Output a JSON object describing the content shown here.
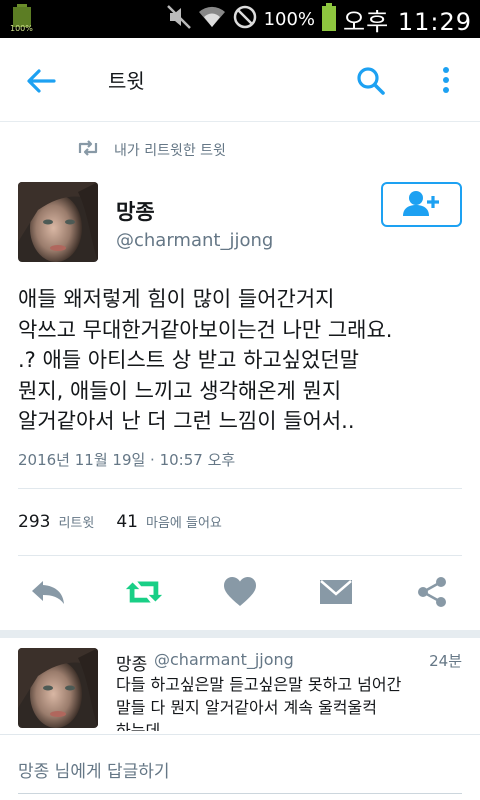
{
  "status_bar": {
    "battery_left_label": "100%",
    "battery_percent": "100%",
    "time": "오후 11:29",
    "icons": [
      "sound-muted-icon",
      "wifi-icon",
      "blocked-icon",
      "battery-icon"
    ]
  },
  "toolbar": {
    "title": "트윗",
    "back_icon": "back-arrow-icon",
    "search_icon": "search-icon",
    "more_icon": "more-vert-icon"
  },
  "tweet": {
    "retweet_context": "내가 리트윗한 트윗",
    "author_name": "망종",
    "author_handle": "@charmant_jjong",
    "text": "애들 왜저렇게 힘이 많이 들어간거지\n악쓰고 무대한거같아보이는건 나만 그래요.\n.? 애들 아티스트 상 받고 하고싶었던말\n뭔지, 애들이 느끼고 생각해온게 뭔지\n알거같아서 난 더 그런 느낌이 들어서..",
    "timestamp": "2016년 11월 19일 · 10:57 오후",
    "retweet_count": "293",
    "retweet_label": "리트윗",
    "like_count": "41",
    "like_label": "마음에 들어요"
  },
  "reply": {
    "author_name": "망종",
    "author_handle": "@charmant_jjong",
    "time": "24분",
    "text": "다들 하고싶은말 듣고싶은말 못하고 넘어간\n말들 다 뭔지 알거같아서 계속 울컥울컥\n하는데"
  },
  "composer": {
    "placeholder": "망종 님에게 답글하기"
  },
  "colors": {
    "accent": "#1da1f2",
    "retweet_active": "#19cf86",
    "icon_gray": "#8899a6",
    "text_secondary": "#657786"
  }
}
